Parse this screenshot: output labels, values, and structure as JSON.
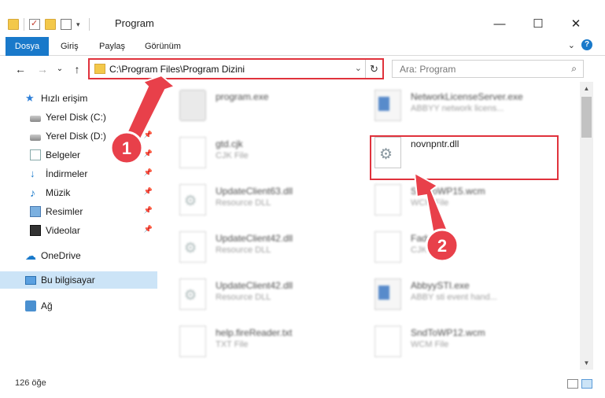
{
  "window": {
    "title": "Program",
    "minimize": "—",
    "maximize": "☐",
    "close": "✕"
  },
  "ribbon": {
    "tabs": [
      "Dosya",
      "Giriş",
      "Paylaş",
      "Görünüm"
    ],
    "expand": "⌄",
    "help": "?"
  },
  "nav": {
    "back": "←",
    "forward": "→",
    "recent": "⌄",
    "up": "↑",
    "address": "C:\\Program Files\\Program Dizini",
    "address_drop": "⌄",
    "refresh": "↻",
    "search_placeholder": "Ara: Program",
    "search_icon": "⌕"
  },
  "sidebar": {
    "items": [
      {
        "label": "Hızlı erişim",
        "icon": "star-icon"
      },
      {
        "label": "Yerel Disk (C:)",
        "icon": "drive-icon"
      },
      {
        "label": "Yerel Disk (D:)",
        "icon": "drive-icon"
      },
      {
        "label": "Belgeler",
        "icon": "documents-icon"
      },
      {
        "label": "İndirmeler",
        "icon": "download-icon"
      },
      {
        "label": "Müzik",
        "icon": "music-icon"
      },
      {
        "label": "Resimler",
        "icon": "pictures-icon"
      },
      {
        "label": "Videolar",
        "icon": "videos-icon"
      },
      {
        "label": "OneDrive",
        "icon": "cloud-icon"
      },
      {
        "label": "Bu bilgisayar",
        "icon": "computer-icon"
      },
      {
        "label": "Ağ",
        "icon": "network-icon"
      }
    ],
    "pin": "📌"
  },
  "files": {
    "left": [
      {
        "name": "program.exe",
        "type": ""
      },
      {
        "name": "gtd.cjk",
        "type": "CJK File"
      },
      {
        "name": "UpdateClient63.dll",
        "type": "Resource DLL"
      },
      {
        "name": "UpdateClient42.dll",
        "type": "Resource DLL"
      },
      {
        "name": "UpdateClient42.dll",
        "type": "Resource DLL"
      },
      {
        "name": "help.fireReader.txt",
        "type": "TXT File"
      }
    ],
    "right": [
      {
        "name": "NetworkLicenseServer.exe",
        "type": "ABBYY network licens..."
      },
      {
        "name": "novnpntr.dll",
        "type": ""
      },
      {
        "name": "SndToWP15.wcm",
        "type": "WCM File"
      },
      {
        "name": "FadeDisk",
        "type": "CJK File"
      },
      {
        "name": "AbbyySTI.exe",
        "type": "ABBY sti event hand..."
      },
      {
        "name": "SndToWP12.wcm",
        "type": "WCM File"
      }
    ]
  },
  "callouts": {
    "one": "1",
    "two": "2",
    "color": "#e0323c"
  },
  "scroll": {
    "up": "▲",
    "down": "▼"
  },
  "status": {
    "count": "126 öğe"
  }
}
